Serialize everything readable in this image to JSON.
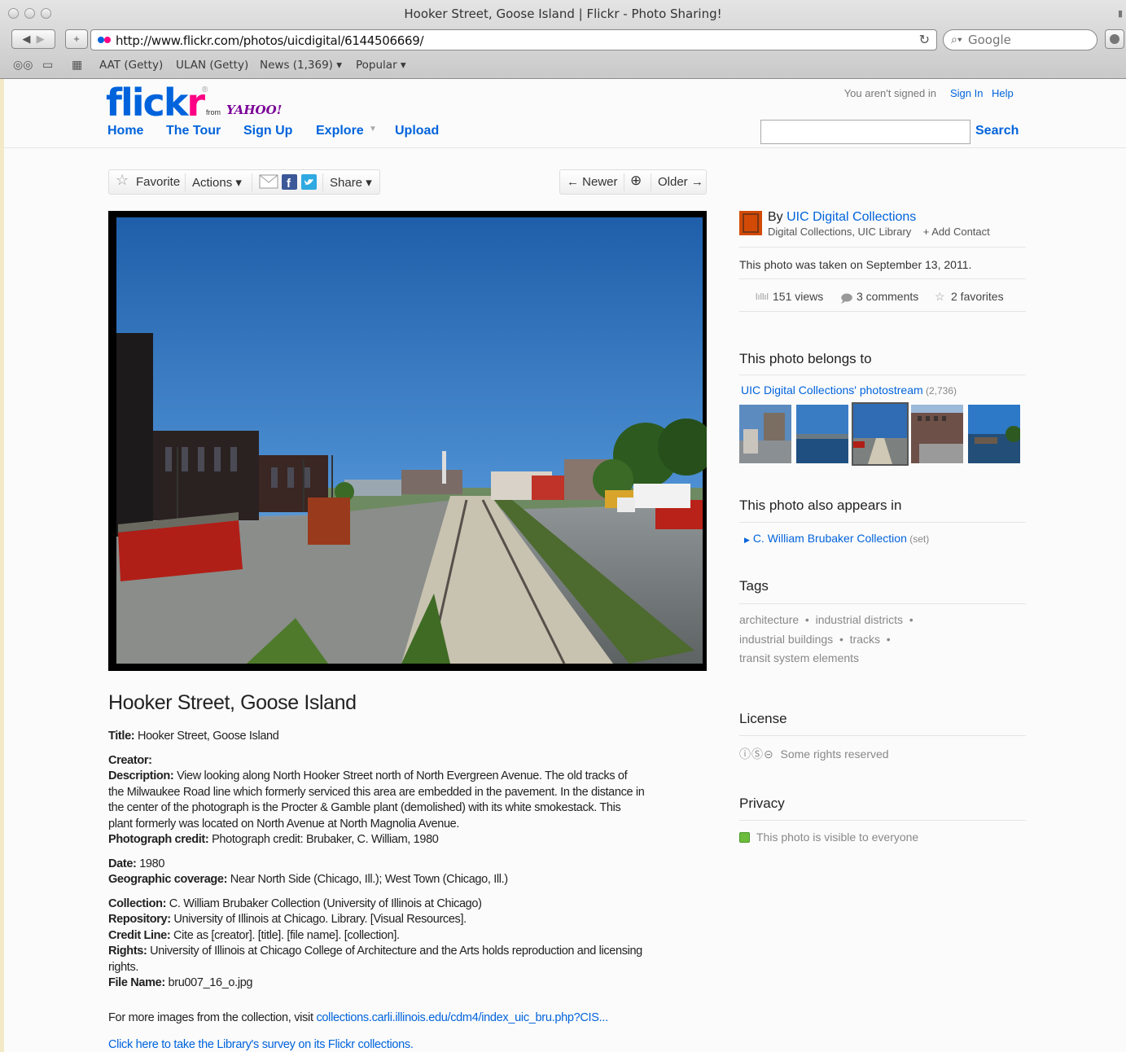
{
  "window": {
    "title": "Hooker Street, Goose Island | Flickr - Photo Sharing!"
  },
  "browser": {
    "url": "http://www.flickr.com/photos/uicdigital/6144506669/",
    "search_placeholder": "Google",
    "bookmarks": [
      "AAT (Getty)",
      "ULAN (Getty)",
      "News (1,369) ▾",
      "Popular ▾"
    ]
  },
  "header": {
    "logo": {
      "flick": "flick",
      "r": "r",
      "reg": "®",
      "from": "from",
      "yahoo": "YAHOO!"
    },
    "nav": [
      "Home",
      "The Tour",
      "Sign Up",
      "Explore",
      "Upload"
    ],
    "signed_status": "You aren't signed in",
    "sign_in": "Sign In",
    "help": "Help",
    "search_button": "Search"
  },
  "actions": {
    "favorite": "Favorite",
    "actions": "Actions ▾",
    "share": "Share ▾",
    "newer": "← Newer",
    "older": "Older →"
  },
  "photo": {
    "title": "Hooker Street, Goose Island",
    "details": {
      "title_label": "Title:",
      "title_value": " Hooker Street, Goose Island",
      "creator_label": "Creator:",
      "description_label": "Description:",
      "description_value": " View looking along North Hooker Street north of North Evergreen Avenue. The old tracks of the Milwaukee Road line which formerly serviced this area are embedded in the pavement. In the distance in the center of the photograph is the Procter & Gamble plant (demolished) with its white smokestack. This plant formerly was located on North Avenue at North Magnolia Avenue.",
      "credit_label": "Photograph credit:",
      "credit_value": " Photograph credit: Brubaker, C. William, 1980",
      "date_label": "Date:",
      "date_value": " 1980",
      "geo_label": "Geographic coverage:",
      "geo_value": " Near North Side (Chicago, Ill.); West Town (Chicago, Ill.)",
      "collection_label": "Collection:",
      "collection_value": " C. William Brubaker Collection (University of Illinois at Chicago)",
      "repository_label": "Repository:",
      "repository_value": " University of Illinois at Chicago. Library. [Visual Resources].",
      "creditline_label": "Credit Line:",
      "creditline_value": " Cite as [creator]. [title]. [file name]. [collection].",
      "rights_label": "Rights:",
      "rights_value": " University of Illinois at Chicago College of Architecture and the Arts holds reproduction and licensing rights.",
      "filename_label": "File Name:",
      "filename_value": " bru007_16_o.jpg"
    },
    "more_prefix": "For more images from the collection, visit ",
    "more_link": "collections.carli.illinois.edu/cdm4/index_uic_bru.php?CIS...",
    "survey_link": "Click here to take the Library's survey on its Flickr collections."
  },
  "sidebar": {
    "by": "By ",
    "owner": "UIC Digital Collections",
    "owner_sub": "Digital Collections, UIC Library",
    "add_contact": "+ Add Contact",
    "taken": "This photo was taken on September 13, 2011.",
    "views": "151 views",
    "comments": "3 comments",
    "favorites": "2 favorites",
    "belongs_heading": "This photo belongs to",
    "stream_link": "UIC Digital Collections' photostream",
    "stream_count": " (2,736)",
    "appears_heading": "This photo also appears in",
    "set_link": "C. William Brubaker Collection",
    "set_suffix": " (set)",
    "tags_heading": "Tags",
    "tags": [
      "architecture",
      "industrial districts",
      "industrial buildings",
      "tracks",
      "transit system elements"
    ],
    "license_heading": "License",
    "license_text": "Some rights reserved",
    "privacy_heading": "Privacy",
    "privacy_text": "This photo is visible to everyone"
  },
  "colors": {
    "link": "#0063dc",
    "flickr_pink": "#ff0084",
    "yahoo_purple": "#7b0099",
    "privacy_green": "#6cbb3c"
  }
}
